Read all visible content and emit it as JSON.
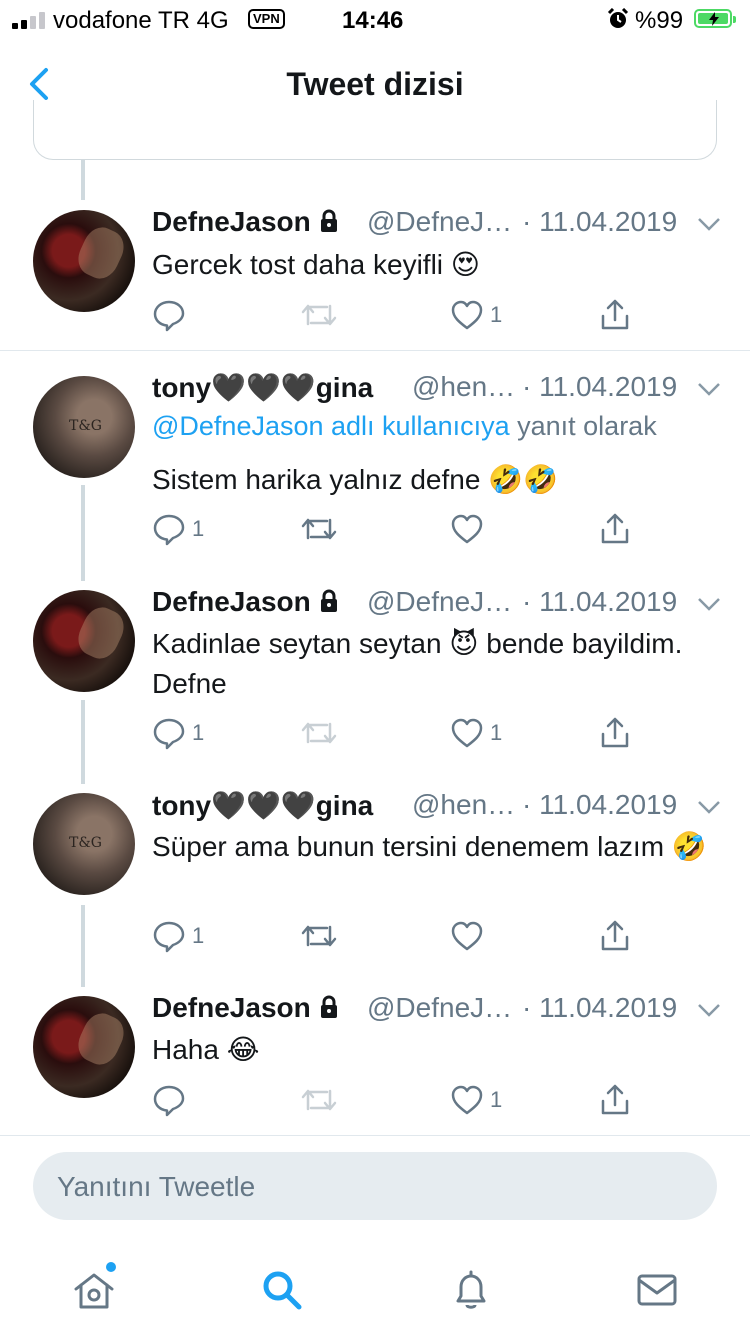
{
  "status_bar": {
    "carrier": "vodafone TR",
    "network": "4G",
    "vpn": "VPN",
    "time": "14:46",
    "battery_pct": "%99",
    "battery_level": 0.99,
    "signal_bars_active": 2
  },
  "nav": {
    "title": "Tweet dizisi",
    "back_icon": "chevron-left-icon"
  },
  "colors": {
    "accent": "#1da1f2",
    "muted": "#657786",
    "battery": "#4cd964",
    "divider": "#e1e8ed"
  },
  "tweets": [
    {
      "name": "DefneJason",
      "locked": true,
      "handle": "@DefneJ…",
      "date": "· 11.04.2019",
      "body": "Gercek tost daha keyifli 😍",
      "reply_count": "",
      "like_count": "1"
    },
    {
      "name": "tony🖤🖤🖤gina",
      "locked": false,
      "handle": "@hen…",
      "date": "· 11.04.2019",
      "reply_to_link": "@DefneJason adlı kullanıcıya",
      "reply_to_rest": "yanıt olarak",
      "body": "Sistem harika yalnız defne 🤣🤣",
      "reply_count": "1",
      "like_count": ""
    },
    {
      "name": "DefneJason",
      "locked": true,
      "handle": "@DefneJ…",
      "date": "· 11.04.2019",
      "body": "Kadinlae seytan seytan 😈 bende bayildim. Defne",
      "reply_count": "1",
      "like_count": "1"
    },
    {
      "name": "tony🖤🖤🖤gina",
      "locked": false,
      "handle": "@hen…",
      "date": "· 11.04.2019",
      "body": "Süper ama bunun tersini denemem lazım 🤣",
      "reply_count": "1",
      "like_count": ""
    },
    {
      "name": "DefneJason",
      "locked": true,
      "handle": "@DefneJ…",
      "date": "· 11.04.2019",
      "body": "Haha 😂",
      "reply_count": "",
      "like_count": "1"
    }
  ],
  "avatars": {
    "tony_text": "T&G"
  },
  "composer": {
    "placeholder": "Yanıtını Tweetle"
  },
  "tabbar": {
    "items": [
      {
        "icon": "home-icon",
        "active": false,
        "badge": true
      },
      {
        "icon": "search-icon",
        "active": true,
        "badge": false
      },
      {
        "icon": "bell-icon",
        "active": false,
        "badge": false
      },
      {
        "icon": "mail-icon",
        "active": false,
        "badge": false
      }
    ]
  }
}
